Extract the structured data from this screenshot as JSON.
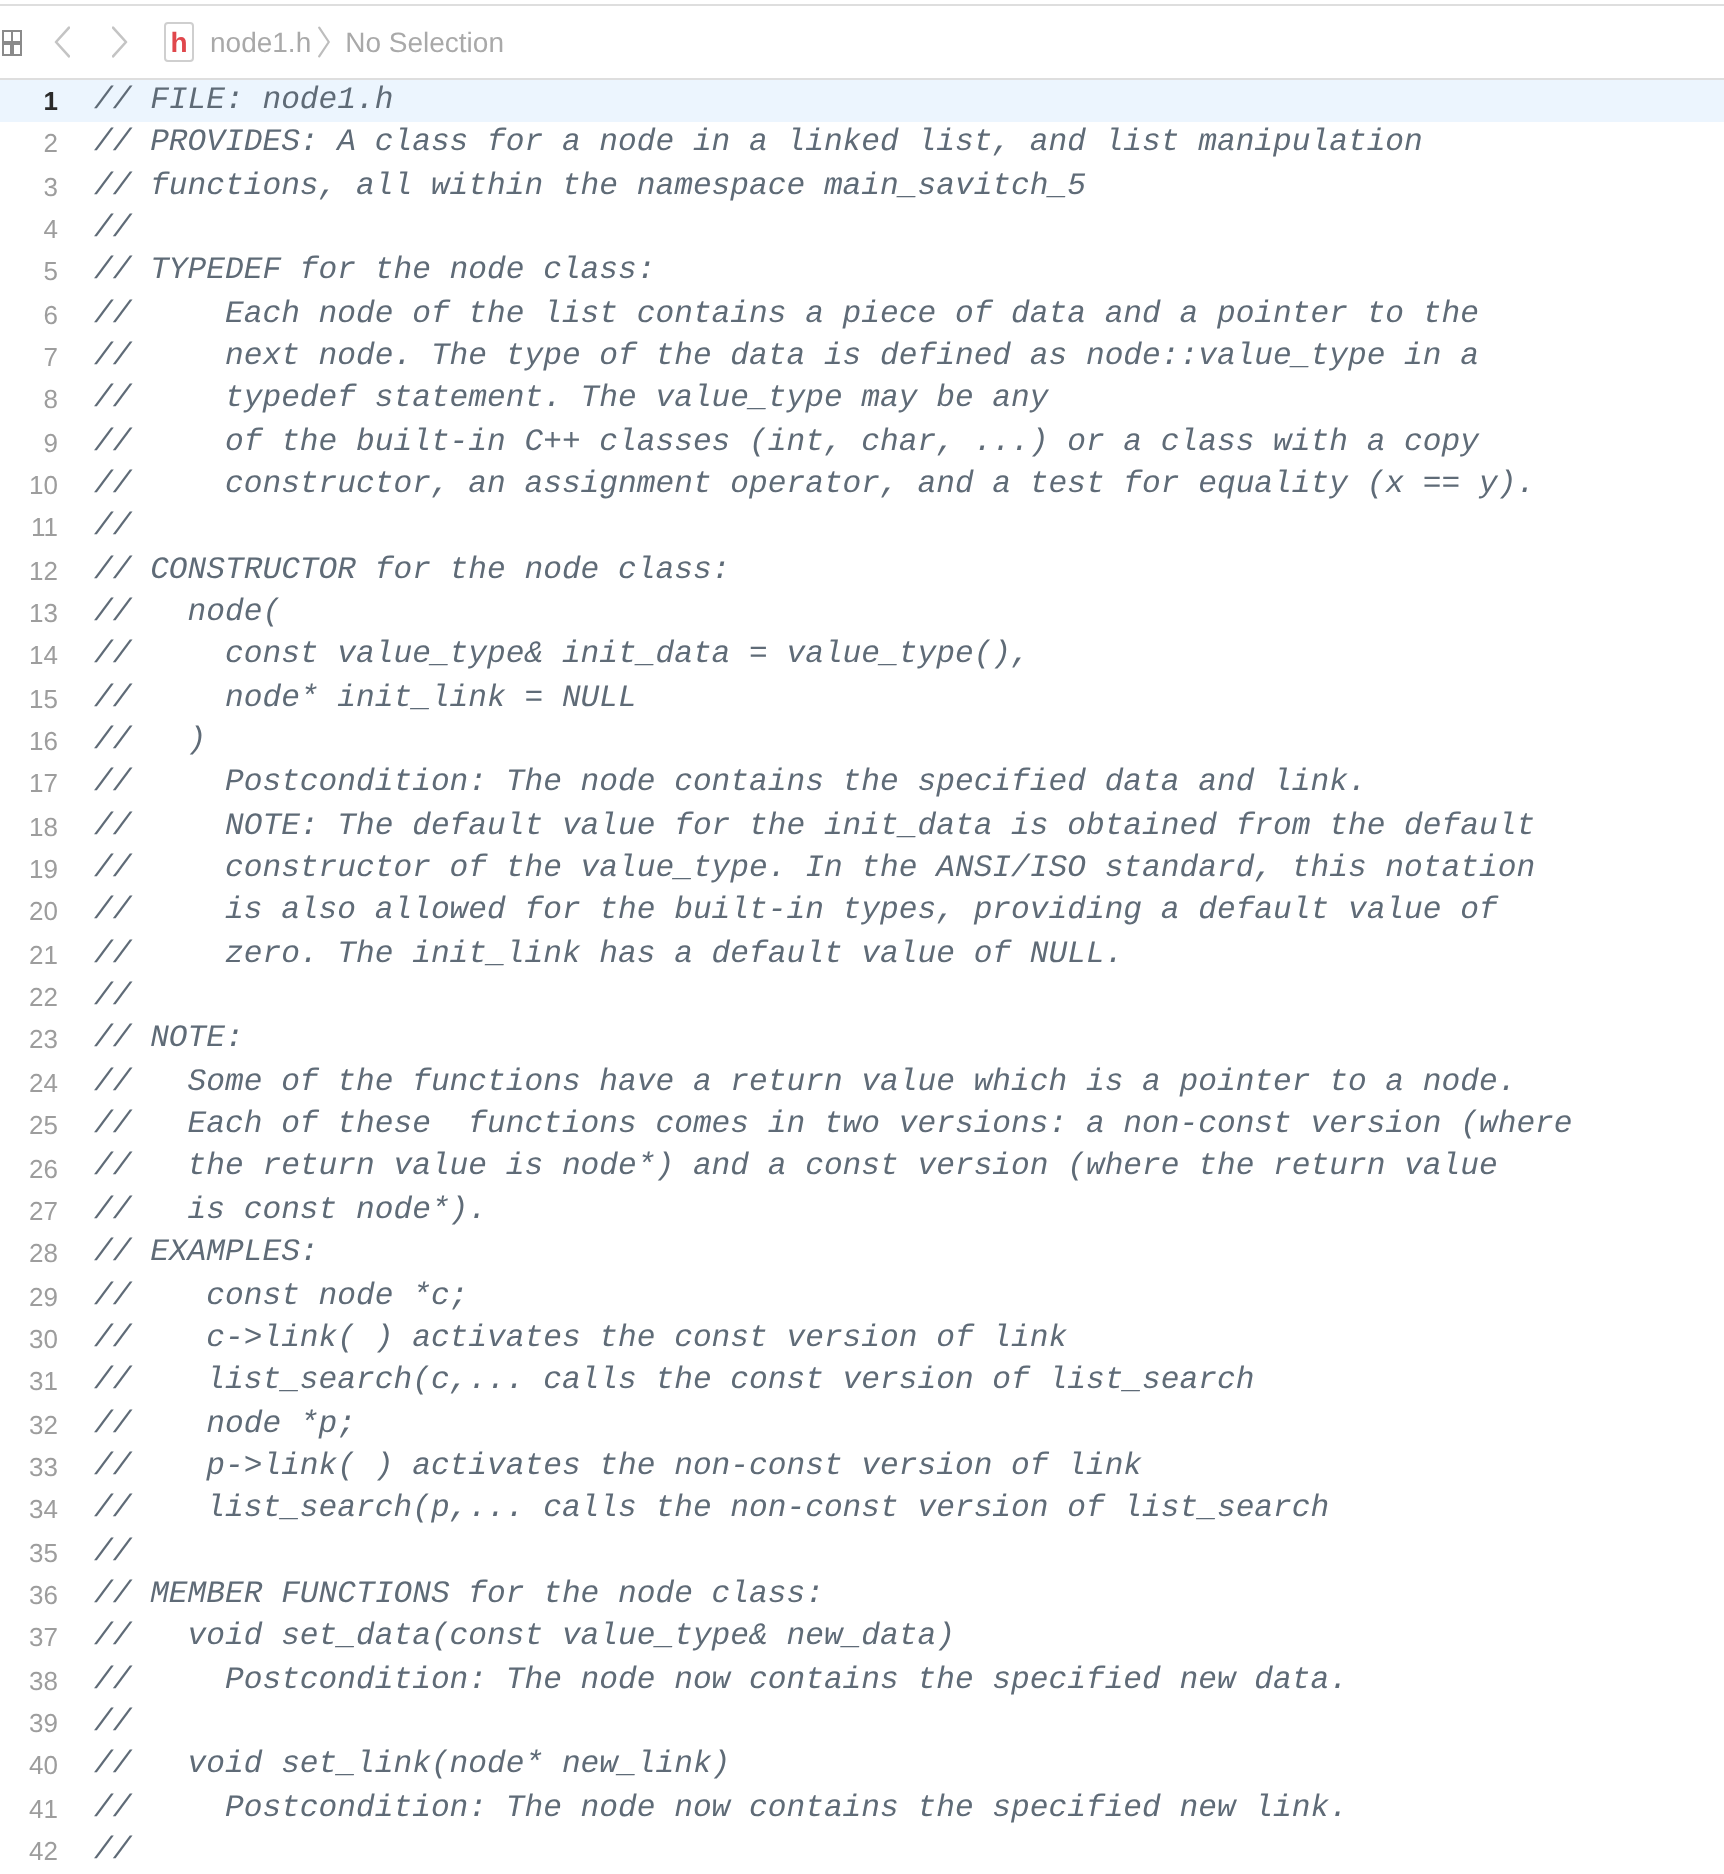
{
  "jump_bar": {
    "file_icon_letter": "h",
    "file": "node1.h",
    "selection": "No Selection"
  },
  "lines": [
    {
      "number": "1",
      "text": "// FILE: node1.h",
      "current": true
    },
    {
      "number": "2",
      "text": "// PROVIDES: A class for a node in a linked list, and list manipulation",
      "current": false
    },
    {
      "number": "3",
      "text": "// functions, all within the namespace main_savitch_5",
      "current": false
    },
    {
      "number": "4",
      "text": "//",
      "current": false
    },
    {
      "number": "5",
      "text": "// TYPEDEF for the node class:",
      "current": false
    },
    {
      "number": "6",
      "text": "//     Each node of the list contains a piece of data and a pointer to the",
      "current": false
    },
    {
      "number": "7",
      "text": "//     next node. The type of the data is defined as node::value_type in a",
      "current": false
    },
    {
      "number": "8",
      "text": "//     typedef statement. The value_type may be any",
      "current": false
    },
    {
      "number": "9",
      "text": "//     of the built-in C++ classes (int, char, ...) or a class with a copy",
      "current": false
    },
    {
      "number": "10",
      "text": "//     constructor, an assignment operator, and a test for equality (x == y).",
      "current": false
    },
    {
      "number": "11",
      "text": "//",
      "current": false
    },
    {
      "number": "12",
      "text": "// CONSTRUCTOR for the node class:",
      "current": false
    },
    {
      "number": "13",
      "text": "//   node(",
      "current": false
    },
    {
      "number": "14",
      "text": "//     const value_type& init_data = value_type(),",
      "current": false
    },
    {
      "number": "15",
      "text": "//     node* init_link = NULL",
      "current": false
    },
    {
      "number": "16",
      "text": "//   )",
      "current": false
    },
    {
      "number": "17",
      "text": "//     Postcondition: The node contains the specified data and link.",
      "current": false
    },
    {
      "number": "18",
      "text": "//     NOTE: The default value for the init_data is obtained from the default",
      "current": false
    },
    {
      "number": "19",
      "text": "//     constructor of the value_type. In the ANSI/ISO standard, this notation",
      "current": false
    },
    {
      "number": "20",
      "text": "//     is also allowed for the built-in types, providing a default value of",
      "current": false
    },
    {
      "number": "21",
      "text": "//     zero. The init_link has a default value of NULL.",
      "current": false
    },
    {
      "number": "22",
      "text": "//",
      "current": false
    },
    {
      "number": "23",
      "text": "// NOTE:",
      "current": false
    },
    {
      "number": "24",
      "text": "//   Some of the functions have a return value which is a pointer to a node.",
      "current": false
    },
    {
      "number": "25",
      "text": "//   Each of these  functions comes in two versions: a non-const version (where",
      "current": false
    },
    {
      "number": "26",
      "text": "//   the return value is node*) and a const version (where the return value",
      "current": false
    },
    {
      "number": "27",
      "text": "//   is const node*).",
      "current": false
    },
    {
      "number": "28",
      "text": "// EXAMPLES:",
      "current": false
    },
    {
      "number": "29",
      "text": "//    const node *c;",
      "current": false
    },
    {
      "number": "30",
      "text": "//    c->link( ) activates the const version of link",
      "current": false
    },
    {
      "number": "31",
      "text": "//    list_search(c,... calls the const version of list_search",
      "current": false
    },
    {
      "number": "32",
      "text": "//    node *p;",
      "current": false
    },
    {
      "number": "33",
      "text": "//    p->link( ) activates the non-const version of link",
      "current": false
    },
    {
      "number": "34",
      "text": "//    list_search(p,... calls the non-const version of list_search",
      "current": false
    },
    {
      "number": "35",
      "text": "//",
      "current": false
    },
    {
      "number": "36",
      "text": "// MEMBER FUNCTIONS for the node class:",
      "current": false
    },
    {
      "number": "37",
      "text": "//   void set_data(const value_type& new_data)",
      "current": false
    },
    {
      "number": "38",
      "text": "//     Postcondition: The node now contains the specified new data.",
      "current": false
    },
    {
      "number": "39",
      "text": "//",
      "current": false
    },
    {
      "number": "40",
      "text": "//   void set_link(node* new_link)",
      "current": false
    },
    {
      "number": "41",
      "text": "//     Postcondition: The node now contains the specified new link.",
      "current": false
    },
    {
      "number": "42",
      "text": "//",
      "current": false
    }
  ]
}
